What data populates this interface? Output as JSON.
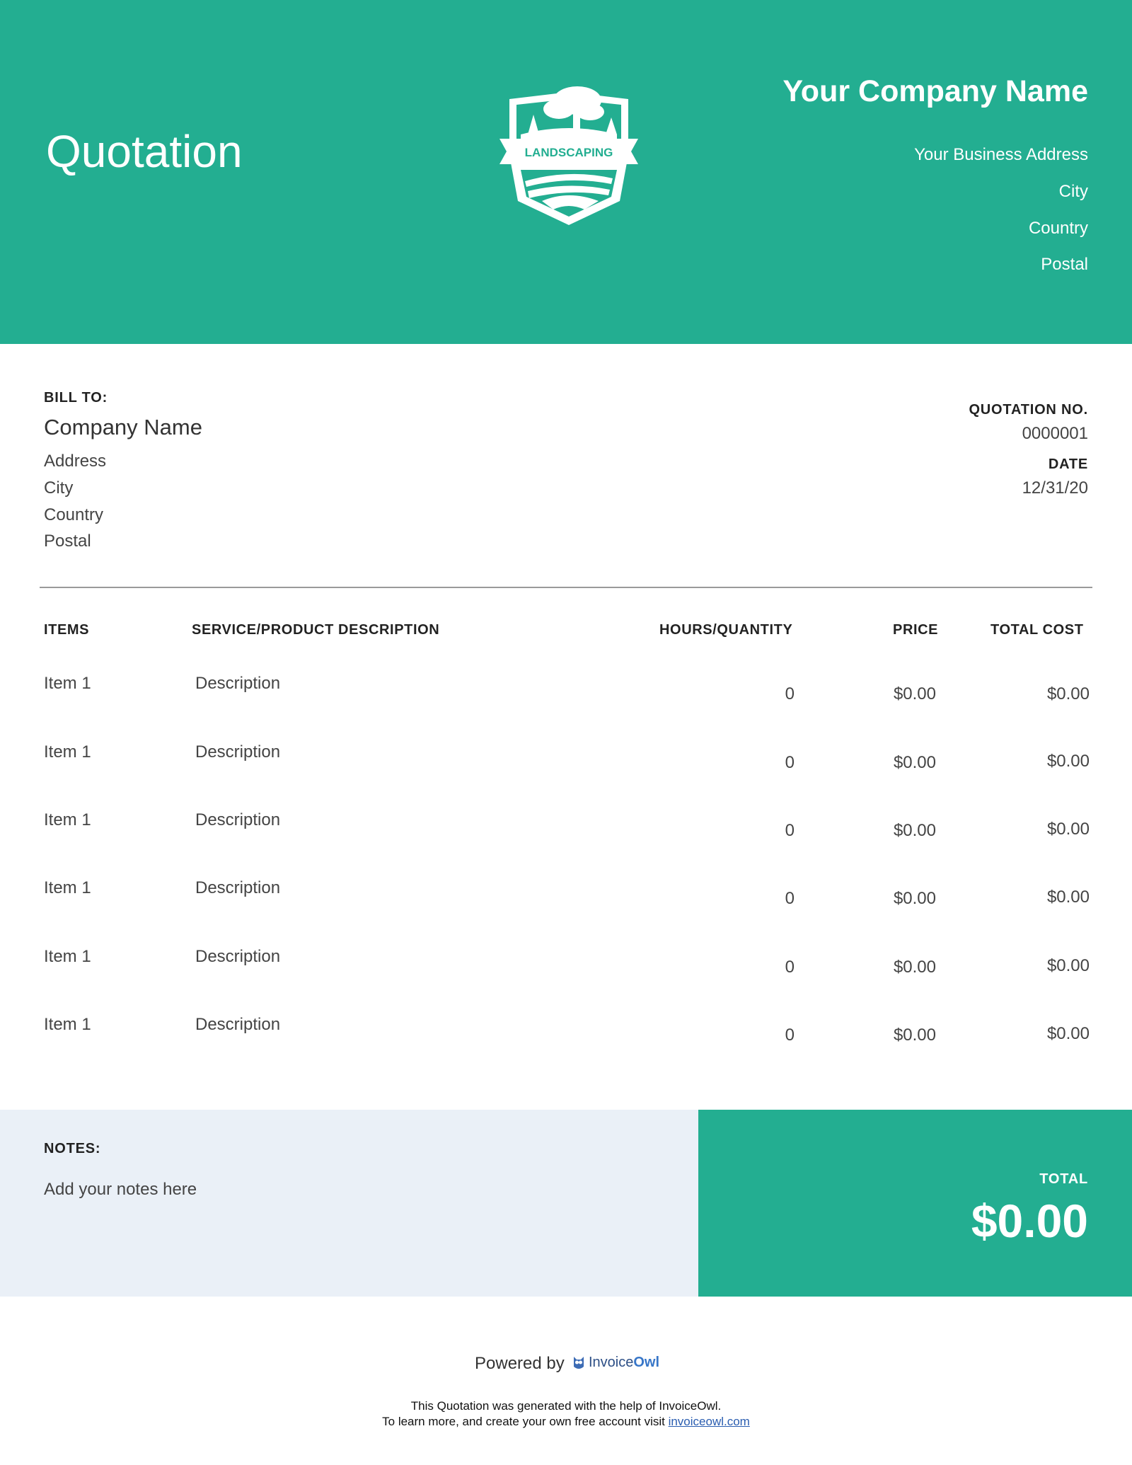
{
  "header": {
    "title": "Quotation",
    "logo_text": "LANDSCAPING",
    "company_name": "Your Company Name",
    "address": "Your Business Address",
    "city": "City",
    "country": "Country",
    "postal": "Postal",
    "accent_color": "#23ae91"
  },
  "bill_to": {
    "label": "BILL TO:",
    "company": "Company Name",
    "address": "Address",
    "city": "City",
    "country": "Country",
    "postal": "Postal"
  },
  "quote_meta": {
    "number_label": "QUOTATION NO.",
    "number": "0000001",
    "date_label": "DATE",
    "date": "12/31/20"
  },
  "table": {
    "headers": [
      "ITEMS",
      "SERVICE/PRODUCT DESCRIPTION",
      "HOURS/QUANTITY",
      "PRICE",
      "TOTAL COST"
    ],
    "rows": [
      {
        "item": "Item 1",
        "description": "Description",
        "quantity": "0",
        "price": "$0.00",
        "total": "$0.00"
      },
      {
        "item": "Item 1",
        "description": "Description",
        "quantity": "0",
        "price": "$0.00",
        "total": "$0.00"
      },
      {
        "item": "Item 1",
        "description": "Description",
        "quantity": "0",
        "price": "$0.00",
        "total": "$0.00"
      },
      {
        "item": "Item 1",
        "description": "Description",
        "quantity": "0",
        "price": "$0.00",
        "total": "$0.00"
      },
      {
        "item": "Item 1",
        "description": "Description",
        "quantity": "0",
        "price": "$0.00",
        "total": "$0.00"
      },
      {
        "item": "Item 1",
        "description": "Description",
        "quantity": "0",
        "price": "$0.00",
        "total": "$0.00"
      }
    ]
  },
  "notes": {
    "label": "NOTES:",
    "text": "Add your notes here"
  },
  "total": {
    "label": "TOTAL",
    "value": "$0.00"
  },
  "footer": {
    "powered_by": "Powered by",
    "brand_name_a": "Invoice",
    "brand_name_b": "Owl",
    "line1": "This Quotation was generated with the help of InvoiceOwl.",
    "line2_prefix": "To learn more, and create your own free account visit ",
    "link_text": "invoiceowl.com"
  }
}
